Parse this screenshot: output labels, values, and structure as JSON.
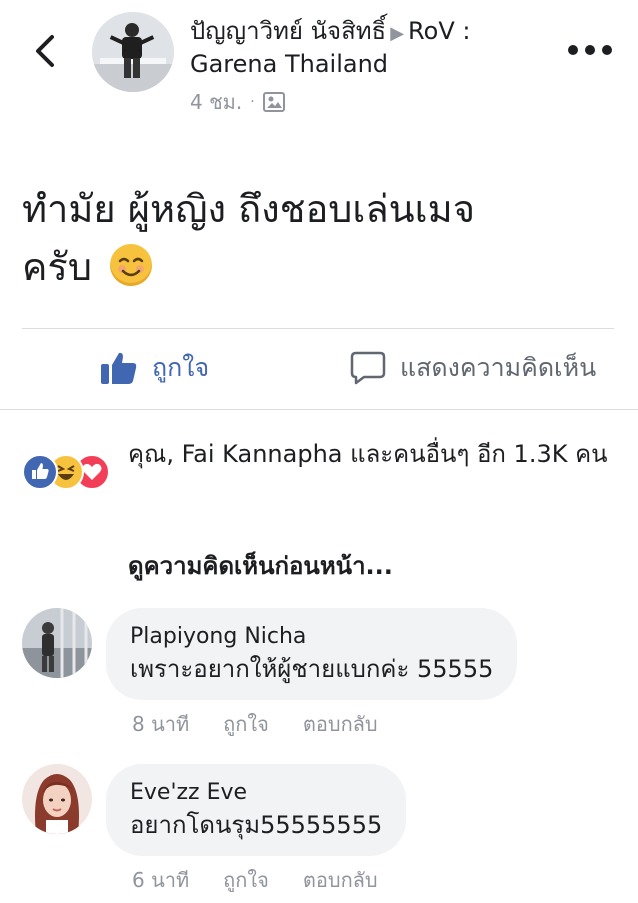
{
  "post": {
    "author": "ปัญญาวิทย์ นัจสิทธิ์",
    "arrow": "▶",
    "group": "RoV : Garena Thailand",
    "time": "4 ชม.",
    "dot": "·",
    "text_line1": "ทำมัย ผู้หญิง ถึงชอบเล่นเมจ",
    "text_line2": "ครับ"
  },
  "actions": {
    "like_label": "ถูกใจ",
    "comment_label": "แสดงความคิดเห็น"
  },
  "reactions": {
    "summary": "คุณ, Fai Kannapha และคนอื่นๆ อีก 1.3K คน",
    "types": [
      "like-icon",
      "haha-icon",
      "love-icon"
    ]
  },
  "prev_comments_label": "ดูความคิดเห็นก่อนหน้า...",
  "comments": [
    {
      "name": "Plapiyong Nicha",
      "text": "เพราะอยากให้ผู้ชายแบกค่ะ 55555",
      "time": "8 นาที",
      "like": "ถูกใจ",
      "reply": "ตอบกลับ"
    },
    {
      "name": "Eve'zz Eve",
      "text": "อยากโดนรุม55555555",
      "time": "6 นาที",
      "like": "ถูกใจ",
      "reply": "ตอบกลับ"
    }
  ],
  "colors": {
    "accent": "#4267b2",
    "muted": "#90949c",
    "bubble": "#f2f3f5",
    "love": "#f33e58",
    "haha": "#f7c33e"
  }
}
